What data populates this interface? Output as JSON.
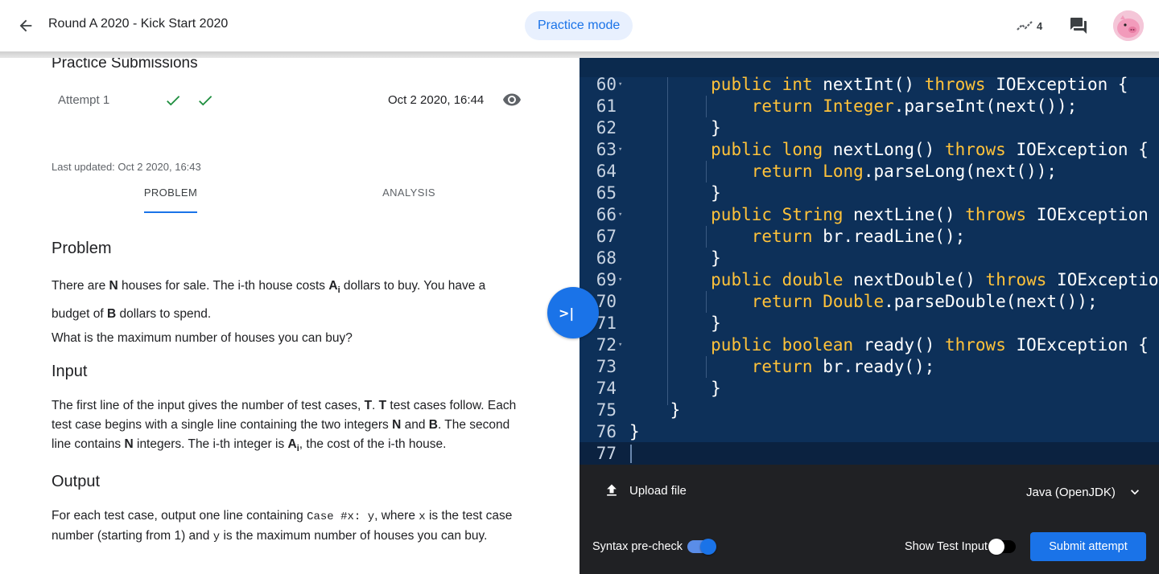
{
  "header": {
    "title": "Round A 2020 - Kick Start 2020",
    "mode_chip": "Practice mode",
    "stats_count": "4"
  },
  "submissions": {
    "title": "Practice Submissions",
    "attempt_label": "Attempt 1",
    "attempt_date": "Oct 2 2020, 16:44",
    "last_updated": "Last updated: Oct 2 2020, 16:43"
  },
  "tabs": [
    {
      "label": "PROBLEM",
      "active": true
    },
    {
      "label": "ANALYSIS",
      "active": false
    }
  ],
  "problem": {
    "heading": "Problem",
    "p1_a": "There are ",
    "p1_N": "N",
    "p1_b": " houses for sale. The i-th house costs ",
    "p1_A": "A",
    "p1_i": "i",
    "p1_c": " dollars to buy. You have a budget of ",
    "p1_B": "B",
    "p1_d": " dollars to spend.",
    "p2": "What is the maximum number of houses you can buy?"
  },
  "input": {
    "heading": "Input",
    "a": "The first line of the input gives the number of test cases, ",
    "T1": "T",
    "b": ". ",
    "T2": "T",
    "c": " test cases follow. Each test case begins with a single line containing the two integers ",
    "N": "N",
    "d": " and ",
    "B": "B",
    "e": ". The second line contains ",
    "N2": "N",
    "f": " integers. The i-th integer is ",
    "A": "A",
    "i": "i",
    "g": ", the cost of the i-th house."
  },
  "output": {
    "heading": "Output",
    "a": "For each test case, output one line containing ",
    "code1": "Case #x: y",
    "b": ", where ",
    "code2": "x",
    "c": " is the test case number (starting from 1) and ",
    "code3": "y",
    "d": " is the maximum number of houses you can buy."
  },
  "code": {
    "lines": [
      {
        "n": "60",
        "fold": true
      },
      {
        "n": "61",
        "fold": false
      },
      {
        "n": "62",
        "fold": false
      },
      {
        "n": "63",
        "fold": true
      },
      {
        "n": "64",
        "fold": false
      },
      {
        "n": "65",
        "fold": false
      },
      {
        "n": "66",
        "fold": true
      },
      {
        "n": "67",
        "fold": false
      },
      {
        "n": "68",
        "fold": false
      },
      {
        "n": "69",
        "fold": true
      },
      {
        "n": "70",
        "fold": false
      },
      {
        "n": "71",
        "fold": false
      },
      {
        "n": "72",
        "fold": true
      },
      {
        "n": "73",
        "fold": false
      },
      {
        "n": "74",
        "fold": false
      },
      {
        "n": "75",
        "fold": false
      },
      {
        "n": "76",
        "fold": false
      },
      {
        "n": "77",
        "fold": false
      }
    ],
    "tokens": [
      [
        [
          "        ",
          ""
        ],
        [
          "public",
          "kw"
        ],
        [
          " ",
          ""
        ],
        [
          "int",
          "kw"
        ],
        [
          " nextInt() ",
          ""
        ],
        [
          "throws",
          "kw"
        ],
        [
          " IOException {",
          ""
        ]
      ],
      [
        [
          "            ",
          ""
        ],
        [
          "return",
          "kw"
        ],
        [
          " ",
          ""
        ],
        [
          "Integer",
          "ty"
        ],
        [
          ".parseInt(next());",
          ""
        ]
      ],
      [
        [
          "        }",
          ""
        ]
      ],
      [
        [
          "        ",
          ""
        ],
        [
          "public",
          "kw"
        ],
        [
          " ",
          ""
        ],
        [
          "long",
          "kw"
        ],
        [
          " nextLong() ",
          ""
        ],
        [
          "throws",
          "kw"
        ],
        [
          " IOException {",
          ""
        ]
      ],
      [
        [
          "            ",
          ""
        ],
        [
          "return",
          "kw"
        ],
        [
          " ",
          ""
        ],
        [
          "Long",
          "ty"
        ],
        [
          ".parseLong(next());",
          ""
        ]
      ],
      [
        [
          "        }",
          ""
        ]
      ],
      [
        [
          "        ",
          ""
        ],
        [
          "public",
          "kw"
        ],
        [
          " ",
          ""
        ],
        [
          "String",
          "ty"
        ],
        [
          " nextLine() ",
          ""
        ],
        [
          "throws",
          "kw"
        ],
        [
          " IOException {",
          ""
        ]
      ],
      [
        [
          "            ",
          ""
        ],
        [
          "return",
          "kw"
        ],
        [
          " br.readLine();",
          ""
        ]
      ],
      [
        [
          "        }",
          ""
        ]
      ],
      [
        [
          "        ",
          ""
        ],
        [
          "public",
          "kw"
        ],
        [
          " ",
          ""
        ],
        [
          "double",
          "kw"
        ],
        [
          " nextDouble() ",
          ""
        ],
        [
          "throws",
          "kw"
        ],
        [
          " IOException {",
          ""
        ]
      ],
      [
        [
          "            ",
          ""
        ],
        [
          "return",
          "kw"
        ],
        [
          " ",
          ""
        ],
        [
          "Double",
          "ty"
        ],
        [
          ".parseDouble(next());",
          ""
        ]
      ],
      [
        [
          "        }",
          ""
        ]
      ],
      [
        [
          "        ",
          ""
        ],
        [
          "public",
          "kw"
        ],
        [
          " ",
          ""
        ],
        [
          "boolean",
          "kw"
        ],
        [
          " ready() ",
          ""
        ],
        [
          "throws",
          "kw"
        ],
        [
          " IOException {",
          ""
        ]
      ],
      [
        [
          "            ",
          ""
        ],
        [
          "return",
          "kw"
        ],
        [
          " br.ready();",
          ""
        ]
      ],
      [
        [
          "        }",
          ""
        ]
      ],
      [
        [
          "    }",
          ""
        ]
      ],
      [
        [
          "}",
          ""
        ]
      ],
      [
        [
          "",
          ""
        ]
      ]
    ]
  },
  "controls": {
    "upload_label": "Upload file",
    "language": "Java (OpenJDK)",
    "syntax_label": "Syntax pre-check",
    "syntax_on": true,
    "show_test_label": "Show Test Input",
    "show_test_on": false,
    "submit_label": "Submit attempt"
  },
  "colors": {
    "accent": "#1a73e8",
    "editor_bg": "#0d3059",
    "keyword": "#ffc23a",
    "check": "#1e8e3e"
  },
  "icons": [
    "back-arrow-icon",
    "trending-icon",
    "forum-icon",
    "avatar-pig",
    "check-icon",
    "eye-icon",
    "collapse-panel-icon",
    "upload-icon",
    "chevron-down-icon"
  ]
}
